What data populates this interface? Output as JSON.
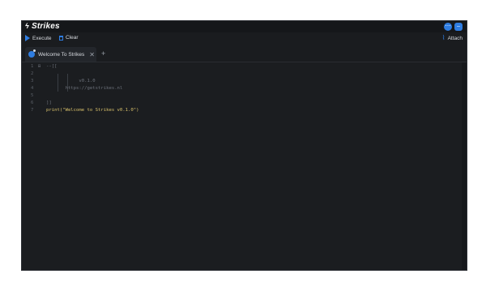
{
  "app": {
    "title": "Strikes"
  },
  "toolbar": {
    "execute_label": "Execute",
    "clear_label": "Clear",
    "attach_label": "Attach"
  },
  "tabs": [
    {
      "label": "Welcome To Strikes"
    }
  ],
  "editor": {
    "lines": [
      {
        "num": "1",
        "text": "--[["
      },
      {
        "num": "2",
        "text": ""
      },
      {
        "num": "3",
        "text": "            v0.1.0"
      },
      {
        "num": "4",
        "text": "       https://getstrikes.nl"
      },
      {
        "num": "5",
        "text": ""
      },
      {
        "num": "6",
        "text": "]]"
      },
      {
        "num": "7",
        "text": "print(\"Welcome to Strikes v0.1.0\")"
      }
    ]
  },
  "colors": {
    "accent": "#2f7de1",
    "background": "#1a1c1f"
  }
}
